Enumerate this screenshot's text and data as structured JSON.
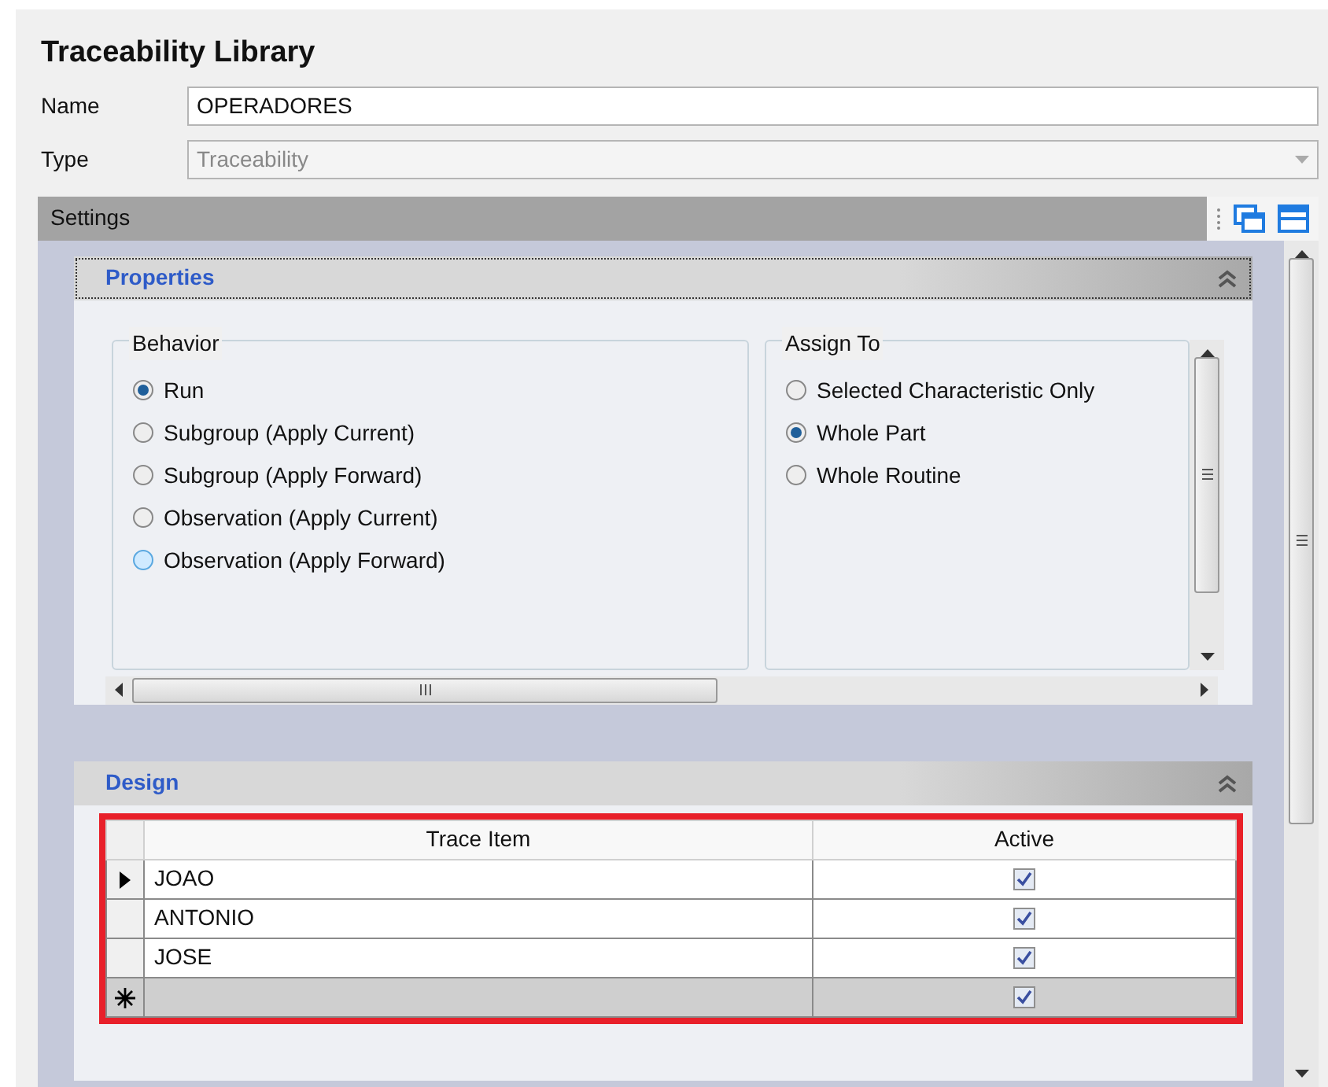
{
  "title": "Traceability Library",
  "fields": [
    {
      "label": "Name",
      "value": "OPERADORES",
      "kind": "text",
      "disabled": false
    },
    {
      "label": "Type",
      "value": "Traceability",
      "kind": "dropdown",
      "disabled": true
    }
  ],
  "settings": {
    "title": "Settings",
    "properties": {
      "title": "Properties",
      "expanded": true,
      "groups": [
        {
          "title": "Behavior",
          "options": [
            {
              "label": "Run",
              "selected": true,
              "hover": false
            },
            {
              "label": "Subgroup (Apply Current)",
              "selected": false,
              "hover": false
            },
            {
              "label": "Subgroup (Apply Forward)",
              "selected": false,
              "hover": false
            },
            {
              "label": "Observation (Apply Current)",
              "selected": false,
              "hover": false
            },
            {
              "label": "Observation (Apply Forward)",
              "selected": false,
              "hover": true
            }
          ]
        },
        {
          "title": "Assign To",
          "options": [
            {
              "label": "Selected Characteristic Only",
              "selected": false,
              "hover": false
            },
            {
              "label": "Whole Part",
              "selected": true,
              "hover": false
            },
            {
              "label": "Whole Routine",
              "selected": false,
              "hover": false
            }
          ]
        }
      ]
    },
    "design": {
      "title": "Design",
      "expanded": true,
      "highlighted": true,
      "columns": [
        "Trace Item",
        "Active"
      ],
      "rows": [
        {
          "current": true,
          "new_row": false,
          "trace_item": "JOAO",
          "active": true
        },
        {
          "current": false,
          "new_row": false,
          "trace_item": "ANTONIO",
          "active": true
        },
        {
          "current": false,
          "new_row": false,
          "trace_item": "JOSE",
          "active": true
        },
        {
          "current": false,
          "new_row": true,
          "active": true
        }
      ]
    }
  }
}
